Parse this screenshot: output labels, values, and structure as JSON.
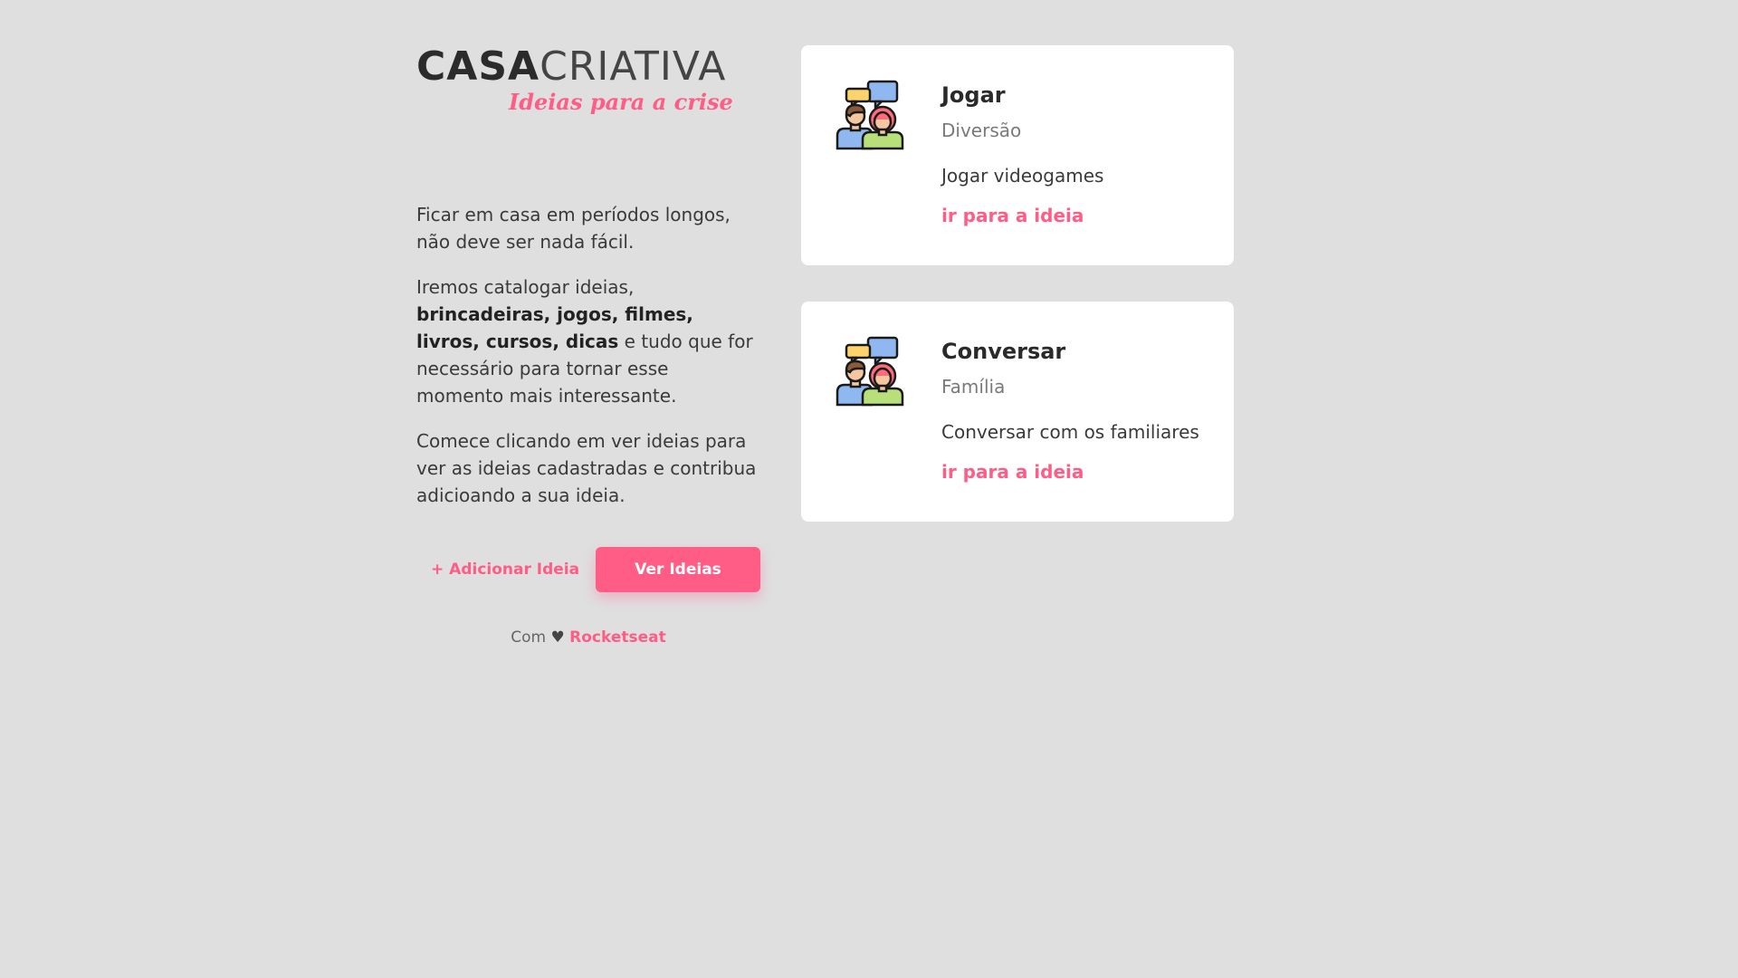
{
  "logo": {
    "main_strong": "CASA",
    "main_light": "CRIATIVA",
    "tagline": "Ideias para a crise"
  },
  "intro": {
    "p1": "Ficar em casa em períodos longos, não deve ser nada fácil.",
    "p2_start": "Iremos catalogar ideias, ",
    "p2_bold": "brincadeiras, jogos, filmes, livros, cursos, dicas",
    "p2_end": " e tudo que for necessário para tornar esse momento mais interessante.",
    "p3": "Comece clicando em ver ideias para ver as ideias cadastradas e contribua adicioando a sua ideia."
  },
  "actions": {
    "add_label": "+ Adicionar Ideia",
    "view_label": "Ver Ideias"
  },
  "footer": {
    "prefix": "Com",
    "heart": "♥",
    "brand": "Rocketseat"
  },
  "ideas": [
    {
      "icon": "people-chat-icon",
      "title": "Jogar",
      "category": "Diversão",
      "description": "Jogar videogames",
      "link": "ir para a ideia"
    },
    {
      "icon": "people-chat-icon",
      "title": "Conversar",
      "category": "Família",
      "description": "Conversar com os familiares",
      "link": "ir para a ideia"
    }
  ],
  "colors": {
    "background": "#dfdfe0",
    "accent": "#ff5c86",
    "card": "#ffffff",
    "text": "#333333"
  }
}
